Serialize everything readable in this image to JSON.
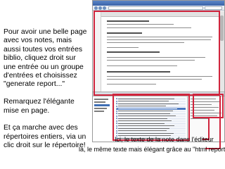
{
  "left_text": {
    "p1": "Pour avoir une belle page avec vos notes, mais aussi toutes vos entrées biblio, cliquez droit sur une entrée ou un groupe d'entrées et choisissez \"generate report...\"",
    "p2": "Remarquez l'élégante mise en page.",
    "p3": "Et ça marche avec des répertoires entiers, via un clic droit sur le répertoire!"
  },
  "captions": {
    "editor_note": "Ici, le texte de la note dans l'éditeur",
    "report_note": "là, le même texte mais élégant grâce au \"html report\"."
  },
  "colors": {
    "highlight": "#d0243c",
    "selection": "#4a78c0"
  }
}
